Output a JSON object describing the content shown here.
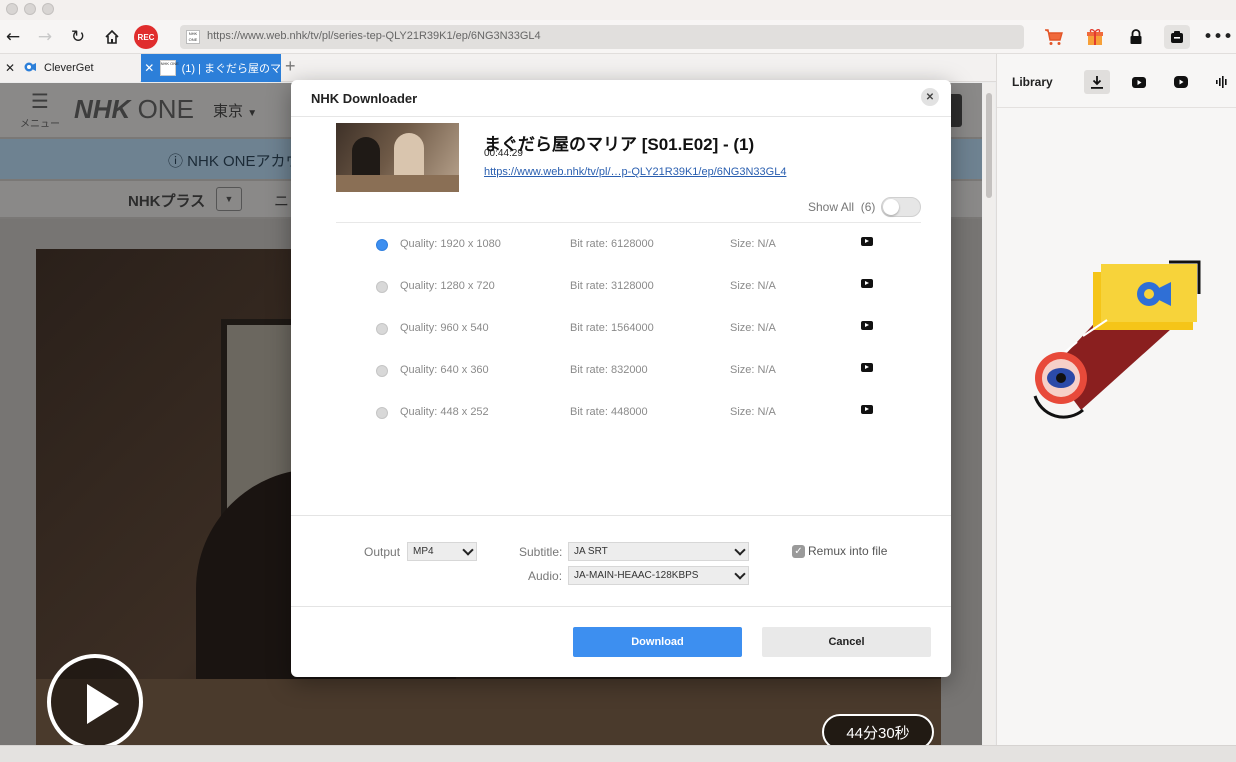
{
  "toolbar": {
    "rec_label": "REC",
    "url": "https://www.web.nhk/tv/pl/series-tep-QLY21R39K1/ep/6NG3N33GL4",
    "favicon_text": "NHK ONE"
  },
  "tabs": [
    {
      "label": "CleverGet",
      "active": false
    },
    {
      "label": "(1) | まぐだら屋のマ",
      "active": true
    }
  ],
  "sidebar": {
    "title": "Library",
    "buttons": [
      "download-icon",
      "youtube-icon",
      "video-icon",
      "audio-wave-icon"
    ]
  },
  "page": {
    "menu_label": "メニュー",
    "logo_nhk": "NHK",
    "logo_one": "ONE",
    "city": "東京",
    "info_text": "ⓘ NHK ONEアカウ",
    "nav_item": "NHKプラス",
    "nav_more": "ニ",
    "duration": "44分30秒"
  },
  "dialog": {
    "title": "NHK Downloader",
    "episode_title": "まぐだら屋のマリア [S01.E02] - (1)",
    "episode_duration": "00:44:29",
    "episode_link": "https://www.web.nhk/tv/pl/…p-QLY21R39K1/ep/6NG3N33GL4",
    "show_all_label": "Show All",
    "show_all_count": "(6)",
    "show_all_on": false,
    "qualities": [
      {
        "quality": "Quality: 1920 x 1080",
        "bitrate": "Bit rate: 6128000",
        "size": "Size: N/A",
        "selected": true
      },
      {
        "quality": "Quality: 1280 x 720",
        "bitrate": "Bit rate: 3128000",
        "size": "Size: N/A",
        "selected": false
      },
      {
        "quality": "Quality: 960 x 540",
        "bitrate": "Bit rate: 1564000",
        "size": "Size: N/A",
        "selected": false
      },
      {
        "quality": "Quality: 640 x 360",
        "bitrate": "Bit rate: 832000",
        "size": "Size: N/A",
        "selected": false
      },
      {
        "quality": "Quality: 448 x 252",
        "bitrate": "Bit rate: 448000",
        "size": "Size: N/A",
        "selected": false
      }
    ],
    "output_label": "Output",
    "output_value": "MP4",
    "subtitle_label": "Subtitle:",
    "subtitle_value": "JA SRT",
    "audio_label": "Audio:",
    "audio_value": "JA-MAIN-HEAAC-128KBPS",
    "remux_label": "Remux into file",
    "remux_checked": true,
    "download_label": "Download",
    "cancel_label": "Cancel"
  },
  "colors": {
    "accent": "#3d8ff0",
    "rec": "#e02d2d",
    "tab_active": "#2c7fd9"
  }
}
